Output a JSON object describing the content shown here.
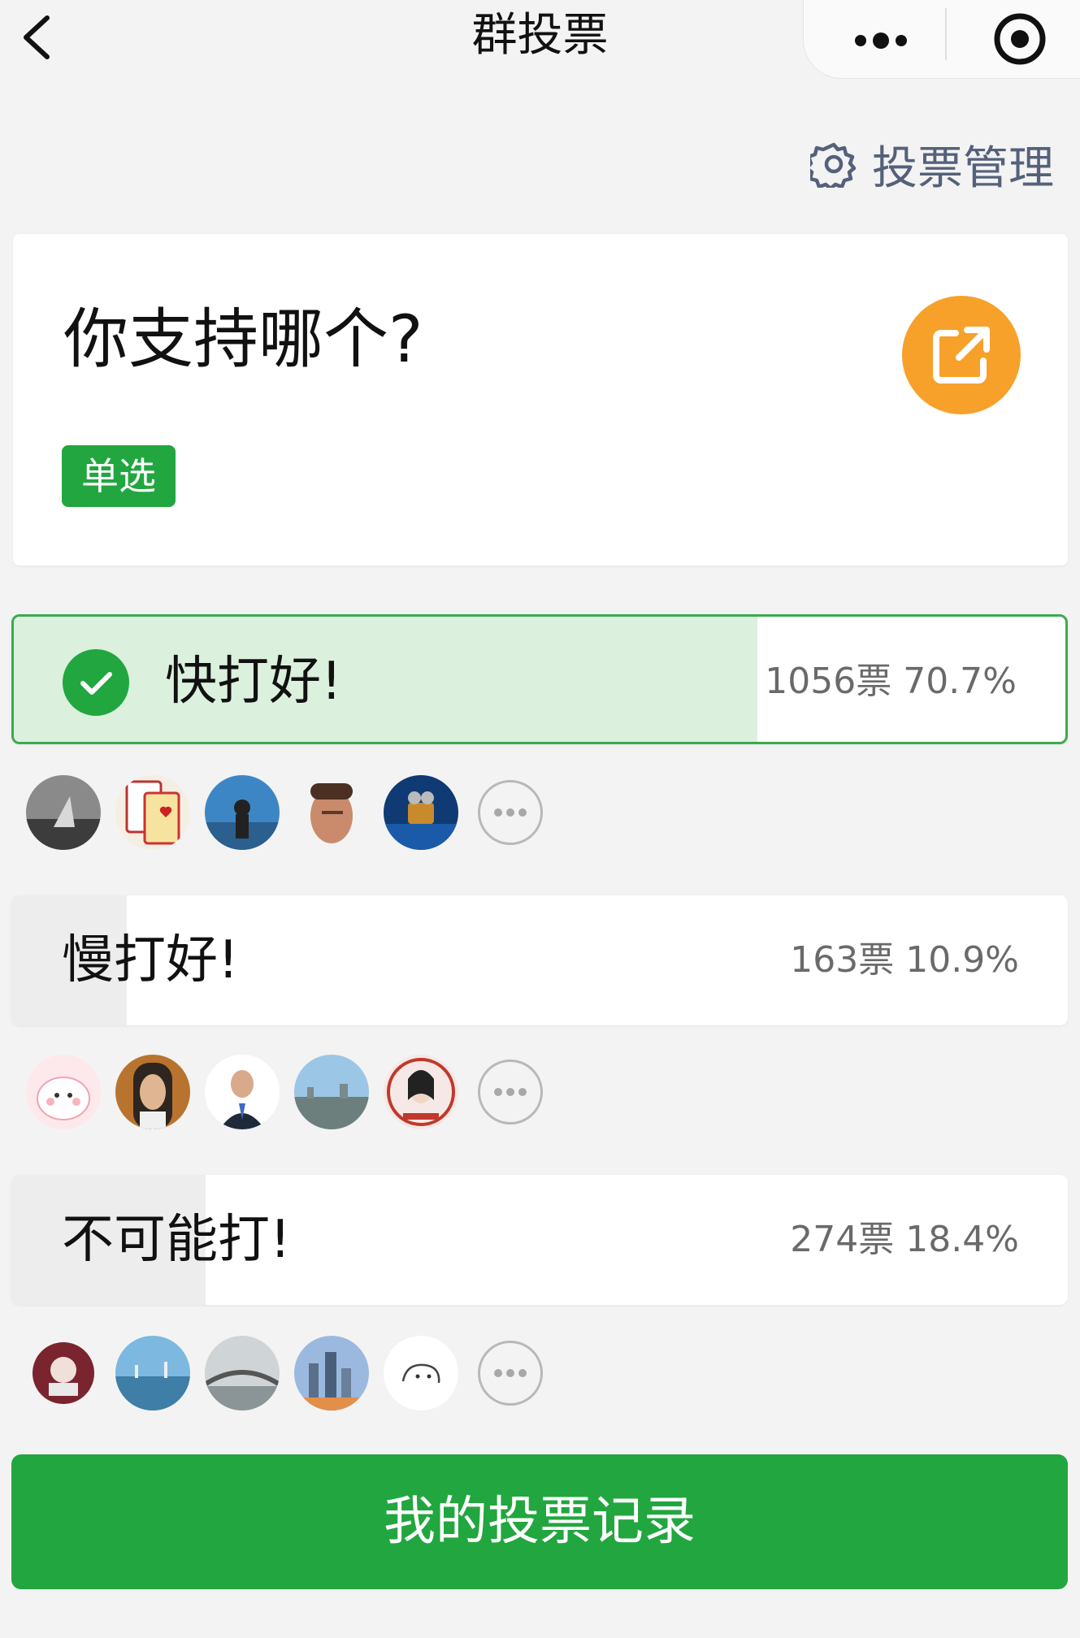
{
  "nav": {
    "title": "群投票"
  },
  "manage": {
    "label": "投票管理"
  },
  "poll": {
    "question": "你支持哪个?",
    "type_tag": "单选"
  },
  "options": [
    {
      "label": "快打好!",
      "stat": "1056票 70.7%",
      "percent": 70.7,
      "selected": true
    },
    {
      "label": "慢打好!",
      "stat": "163票 10.9%",
      "percent": 10.9,
      "selected": false
    },
    {
      "label": "不可能打!",
      "stat": "274票 18.4%",
      "percent": 18.4,
      "selected": false
    }
  ],
  "colors": {
    "primary": "#22a63f",
    "selected_fill": "#dbf0dd",
    "share": "#f7a12b",
    "manage_text": "#55617a"
  },
  "record_button": {
    "label": "我的投票记录"
  }
}
